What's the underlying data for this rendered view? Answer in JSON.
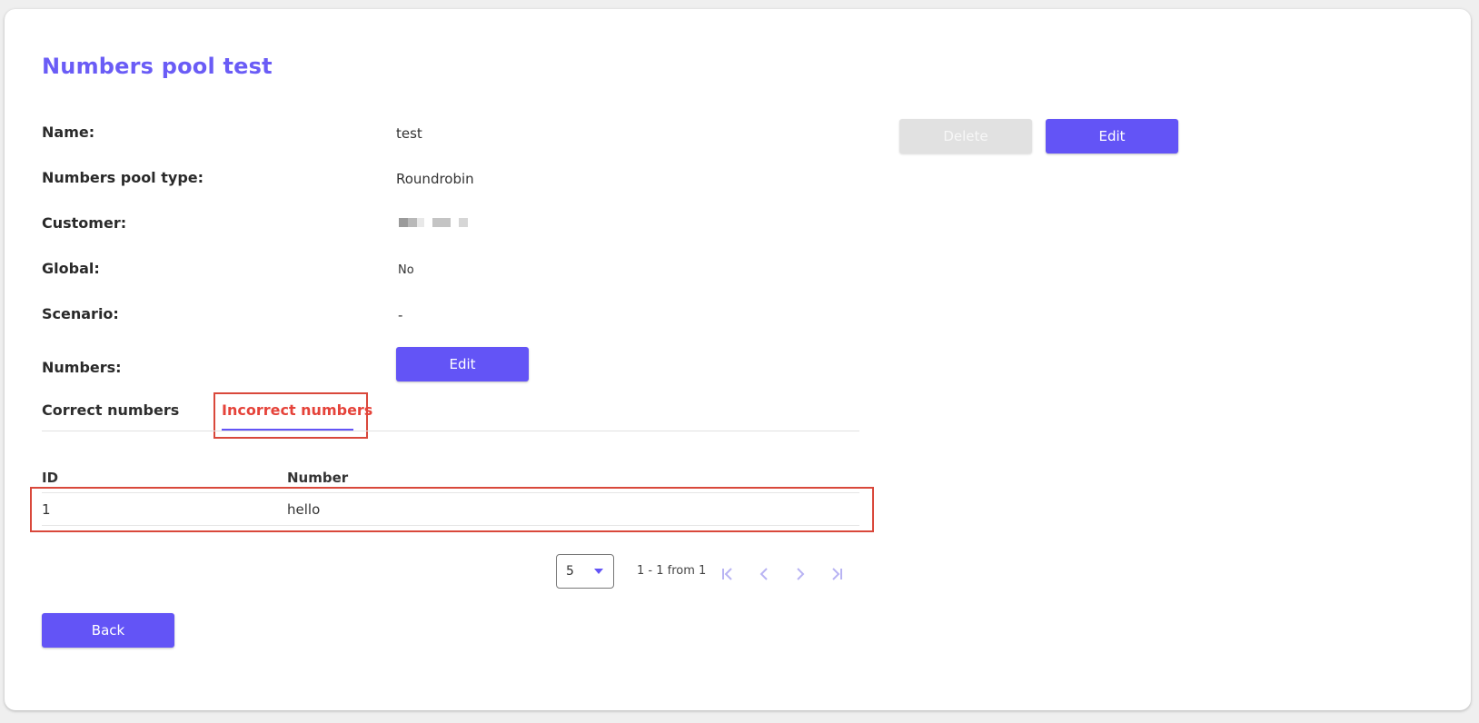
{
  "page": {
    "title": "Numbers pool test"
  },
  "details": {
    "name_label": "Name:",
    "name_value": "test",
    "type_label": "Numbers pool type:",
    "type_value": "Roundrobin",
    "customer_label": "Customer:",
    "global_label": "Global:",
    "global_value": "No",
    "scenario_label": "Scenario:",
    "scenario_value": "-",
    "numbers_label": "Numbers:"
  },
  "actions": {
    "delete_label": "Delete",
    "edit_label": "Edit",
    "numbers_edit_label": "Edit",
    "back_label": "Back"
  },
  "tabs": [
    {
      "label": "Correct numbers",
      "active": false
    },
    {
      "label": "Incorrect numbers",
      "active": true
    }
  ],
  "table": {
    "columns": [
      "ID",
      "Number"
    ],
    "rows": [
      {
        "id": "1",
        "number": "hello"
      }
    ]
  },
  "pagination": {
    "page_size": "5",
    "range_text": "1 - 1 from 1"
  },
  "colors": {
    "accent": "#6354f6",
    "title": "#6a5cf6",
    "active_tab": "#e5433a",
    "highlight_border": "#d9483b",
    "disabled_button": "#e1e1e1"
  },
  "icons": [
    "first-page-icon",
    "previous-page-icon",
    "next-page-icon",
    "last-page-icon",
    "chevron-down-icon"
  ]
}
